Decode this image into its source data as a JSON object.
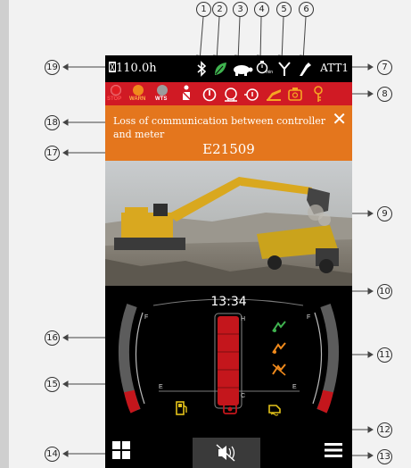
{
  "callouts": {
    "n1": "1",
    "n2": "2",
    "n3": "3",
    "n4": "4",
    "n5": "5",
    "n6": "6",
    "n7": "7",
    "n8": "8",
    "n9": "9",
    "n10": "10",
    "n11": "11",
    "n12": "12",
    "n13": "13",
    "n14": "14",
    "n15": "15",
    "n16": "16",
    "n17": "17",
    "n18": "18",
    "n19": "19"
  },
  "status": {
    "hours": "110.0h",
    "att": "ATT1",
    "icons": [
      "hourglass-icon",
      "bluetooth-icon",
      "eco-leaf-icon",
      "turtle-icon",
      "engine-auto-idle-icon",
      "attachment-icon",
      "hammer-icon"
    ],
    "min_label": "min"
  },
  "indicators": {
    "stop": "STOP",
    "warn": "WARN",
    "wts": "WTS",
    "colors": {
      "stop": "#e01d22",
      "warn": "#f08a1c",
      "wts": "#9c9c9c",
      "bar": "#d01a24"
    }
  },
  "alert": {
    "message": "Loss of communication between controller and meter",
    "code": "E21509",
    "color": "#e4761d"
  },
  "dash": {
    "time": "13:34",
    "fuel_full": "F",
    "fuel_empty": "E",
    "temp_hot": "H",
    "temp_cold": "C",
    "def_full": "F",
    "def_empty": "E"
  }
}
